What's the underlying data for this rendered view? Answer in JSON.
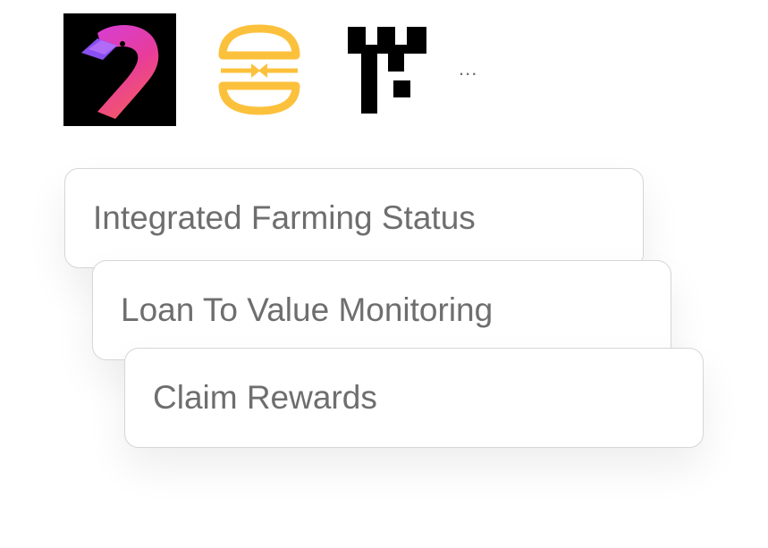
{
  "logos": [
    {
      "icon": "flamingo-logo-icon"
    },
    {
      "icon": "burger-swap-logo-icon"
    },
    {
      "icon": "fortress-logo-icon"
    }
  ],
  "more_label": "...",
  "features": [
    {
      "label": "Integrated Farming Status"
    },
    {
      "label": "Loan To Value Monitoring"
    },
    {
      "label": "Claim Rewards"
    }
  ],
  "colors": {
    "card_text": "#6e6e6e",
    "card_border": "#d6d6d6",
    "burger_yellow": "#fcc13c",
    "flamingo_pink": "#e33ea7",
    "flamingo_purple": "#8a4ff2"
  }
}
